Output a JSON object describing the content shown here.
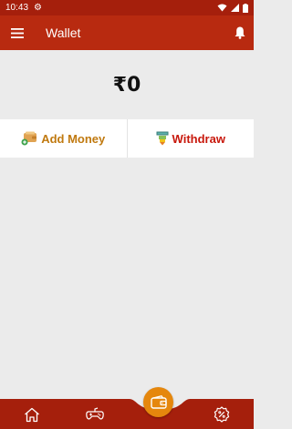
{
  "status_bar": {
    "time": "10:43",
    "icons": [
      "settings-icon",
      "wifi-icon",
      "signal-icon",
      "battery-icon"
    ]
  },
  "app_bar": {
    "title": "Wallet",
    "menu_icon": "menu-icon",
    "notification_icon": "bell-icon"
  },
  "wallet": {
    "balance": "₹0"
  },
  "actions": {
    "add_money_label": "Add Money",
    "withdraw_label": "Withdraw"
  },
  "bottom_nav": {
    "items": [
      "home-icon",
      "gamepad-icon",
      "wallet-icon",
      "offers-icon"
    ]
  },
  "colors": {
    "primary": "#b82a10",
    "status_bar": "#a51f0c",
    "accent": "#e5870d",
    "add_money": "#c0790f",
    "withdraw": "#c8180c",
    "background": "#ebebeb"
  }
}
